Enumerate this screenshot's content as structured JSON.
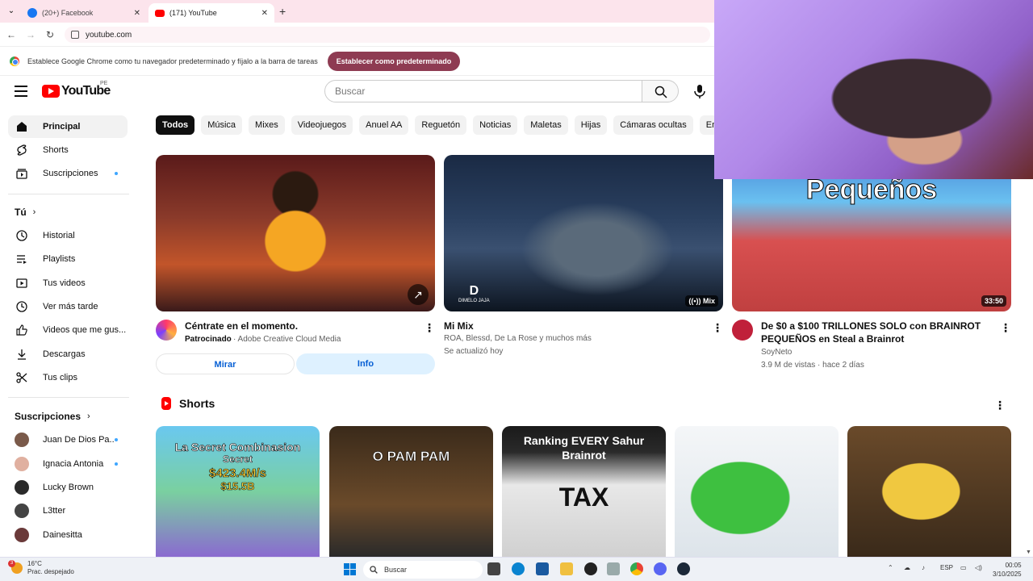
{
  "browser": {
    "tabs": [
      {
        "label": "(20+) Facebook"
      },
      {
        "label": "(171) YouTube"
      }
    ],
    "url": "youtube.com",
    "infobar": {
      "message": "Establece Google Chrome como tu navegador predeterminado y fíjalo a la barra de tareas",
      "button": "Establecer como predeterminado"
    }
  },
  "youtube": {
    "logo": "YouTube",
    "country": "PE",
    "search_placeholder": "Buscar",
    "sidebar": {
      "main": [
        {
          "label": "Principal",
          "icon": "home-icon"
        },
        {
          "label": "Shorts",
          "icon": "shorts-icon"
        },
        {
          "label": "Suscripciones",
          "icon": "subscriptions-icon"
        }
      ],
      "you_heading": "Tú",
      "you": [
        {
          "label": "Historial",
          "icon": "history-icon"
        },
        {
          "label": "Playlists",
          "icon": "playlists-icon"
        },
        {
          "label": "Tus videos",
          "icon": "your-videos-icon"
        },
        {
          "label": "Ver más tarde",
          "icon": "watch-later-icon"
        },
        {
          "label": "Videos que me gus...",
          "icon": "liked-icon"
        },
        {
          "label": "Descargas",
          "icon": "download-icon"
        },
        {
          "label": "Tus clips",
          "icon": "clips-icon"
        }
      ],
      "subs_heading": "Suscripciones",
      "subs": [
        {
          "label": "Juan De Dios Pa...",
          "color": "#7a5a4a"
        },
        {
          "label": "Ignacia Antonia",
          "color": "#e0b0a0"
        },
        {
          "label": "Lucky Brown",
          "color": "#2a2a2a"
        },
        {
          "label": "L3tter",
          "color": "#444444"
        },
        {
          "label": "Dainesitta",
          "color": "#6a3a3a"
        }
      ]
    },
    "chips": [
      "Todos",
      "Música",
      "Mixes",
      "Videojuegos",
      "Anuel AA",
      "Reguetón",
      "Noticias",
      "Maletas",
      "Hijas",
      "Cámaras ocultas",
      "En"
    ],
    "videos": [
      {
        "title": "Céntrate en el momento.",
        "sponsored": "Patrocinado",
        "channel": "· Adobe Creative Cloud Media",
        "buttons": {
          "watch": "Mirar",
          "info": "Info"
        }
      },
      {
        "title": "Mi Mix",
        "line1": "ROA, Blessd, De La Rose y muchos más",
        "line2": "Se actualizó hoy",
        "badge": "Mix",
        "brand": "DIMELO JAJA"
      },
      {
        "title": "De $0 a $100 TRILLONES SOLO con BRAINROT PEQUEÑOS en Steal a Brainrot",
        "thumb_text": "Pequeños",
        "channel": "SoyNeto",
        "stats": "3.9 M de vistas · hace 2 días",
        "duration": "33:50"
      }
    ],
    "shorts_heading": "Shorts",
    "shorts": [
      {
        "lines": [
          "La Secret Combinasion",
          "Secret",
          "$423.4M/s",
          "$15.5B"
        ]
      },
      {
        "lines": [
          "O PAM PAM"
        ]
      },
      {
        "lines": [
          "Ranking EVERY Sahur",
          "Brainrot",
          "TAX"
        ]
      },
      {
        "lines": []
      },
      {
        "lines": []
      }
    ]
  },
  "taskbar": {
    "weather_temp": "16°C",
    "weather_desc": "Prac. despejado",
    "notif_count": "3",
    "search": "Buscar",
    "lang": "ESP",
    "time": "00:05",
    "date": "3/10/2025"
  }
}
